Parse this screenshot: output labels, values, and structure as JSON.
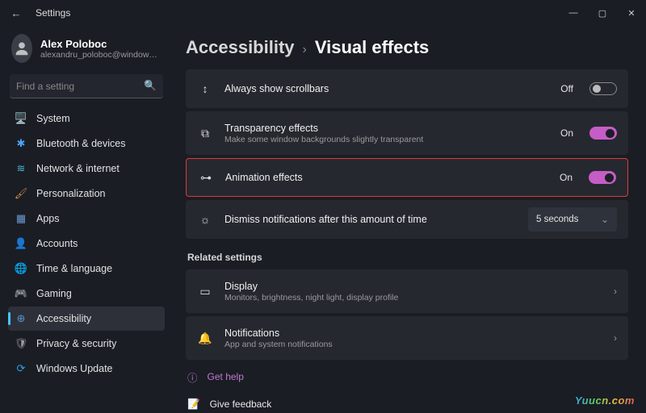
{
  "window": {
    "title": "Settings"
  },
  "user": {
    "name": "Alex Poloboc",
    "email": "alexandru_poloboc@windowsreport..."
  },
  "search": {
    "placeholder": "Find a setting"
  },
  "nav": [
    {
      "label": "System",
      "icon": "🖥️",
      "color": "#5aa7e0"
    },
    {
      "label": "Bluetooth & devices",
      "icon": "✱",
      "color": "#4aa3ff"
    },
    {
      "label": "Network & internet",
      "icon": "≋",
      "color": "#4ab8d6"
    },
    {
      "label": "Personalization",
      "icon": "🖌",
      "color": "#d38a4f"
    },
    {
      "label": "Apps",
      "icon": "▦",
      "color": "#6a9bd1"
    },
    {
      "label": "Accounts",
      "icon": "👤",
      "color": "#c9c9c9"
    },
    {
      "label": "Time & language",
      "icon": "🌐",
      "color": "#66c28a"
    },
    {
      "label": "Gaming",
      "icon": "🎮",
      "color": "#8a8a8a"
    },
    {
      "label": "Accessibility",
      "icon": "⊕",
      "color": "#5a93d0",
      "active": true
    },
    {
      "label": "Privacy & security",
      "icon": "🛡",
      "color": "#9a9a9a"
    },
    {
      "label": "Windows Update",
      "icon": "⟳",
      "color": "#2e9fe6"
    }
  ],
  "breadcrumb": {
    "parent": "Accessibility",
    "sep": "›",
    "current": "Visual effects"
  },
  "settings": {
    "scrollbars": {
      "title": "Always show scrollbars",
      "state": "Off",
      "on": false
    },
    "transparency": {
      "title": "Transparency effects",
      "sub": "Make some window backgrounds slightly transparent",
      "state": "On",
      "on": true
    },
    "animation": {
      "title": "Animation effects",
      "state": "On",
      "on": true,
      "highlighted": true
    },
    "dismiss": {
      "title": "Dismiss notifications after this amount of time",
      "value": "5 seconds"
    }
  },
  "related": {
    "heading": "Related settings",
    "display": {
      "title": "Display",
      "sub": "Monitors, brightness, night light, display profile"
    },
    "notifications": {
      "title": "Notifications",
      "sub": "App and system notifications"
    }
  },
  "footer": {
    "help": "Get help",
    "feedback": "Give feedback"
  },
  "brand": "Yuucn.com"
}
